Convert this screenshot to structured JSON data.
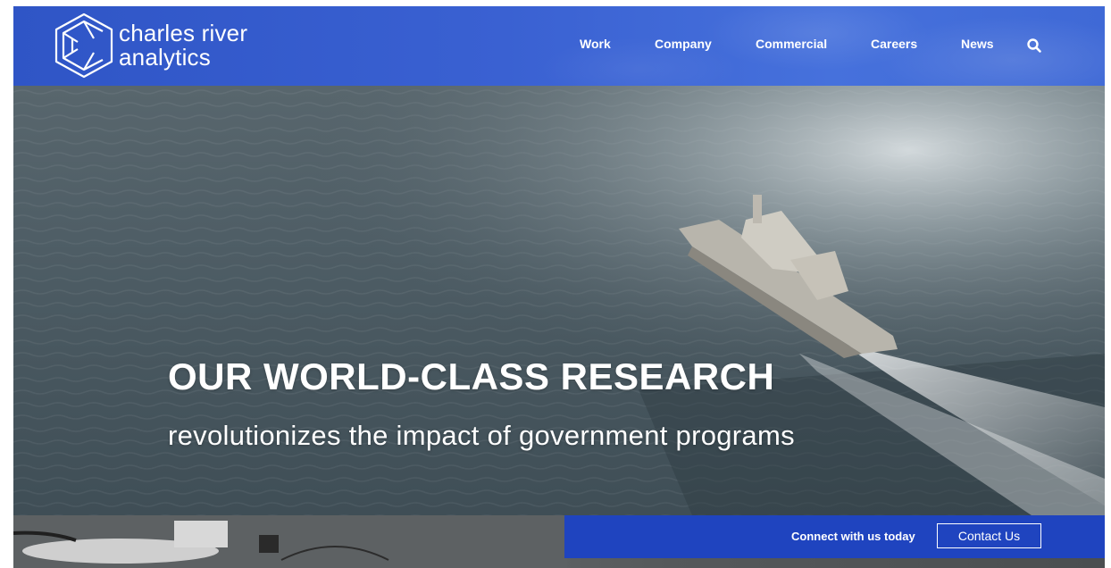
{
  "brand": {
    "line1": "charles river",
    "line2": "analytics",
    "logo_icon": "hexagon-c-logo-icon"
  },
  "nav": {
    "items": [
      {
        "label": "Work"
      },
      {
        "label": "Company"
      },
      {
        "label": "Commercial"
      },
      {
        "label": "Careers"
      },
      {
        "label": "News"
      }
    ],
    "search_icon": "search-icon"
  },
  "hero": {
    "title": "OUR WORLD-CLASS RESEARCH",
    "subtitle": "revolutionizes the impact of government programs",
    "image": "ship-on-water-photo"
  },
  "cta": {
    "text": "Connect with us today",
    "button_label": "Contact Us"
  },
  "colors": {
    "header_blue": "#3a61d2",
    "cta_blue": "#1f44bf",
    "text_white": "#ffffff"
  }
}
